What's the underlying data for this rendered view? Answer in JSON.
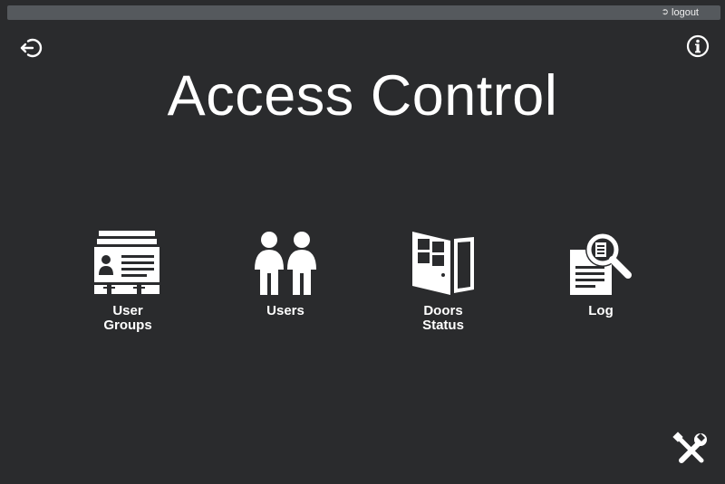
{
  "topbar": {
    "logout_label": "logout",
    "logout_icon": "logout-arrow-icon"
  },
  "header": {
    "title": "Access Control",
    "back_icon": "sign-out-icon",
    "info_icon": "info-icon"
  },
  "tiles": [
    {
      "label": "User Groups",
      "icon": "id-card-stack-icon"
    },
    {
      "label": "Users",
      "icon": "two-people-icon"
    },
    {
      "label": "Doors Status",
      "icon": "open-door-icon"
    },
    {
      "label": "Log",
      "icon": "document-magnifier-icon"
    }
  ],
  "footer": {
    "tools_icon": "wrench-screwdriver-icon"
  },
  "colors": {
    "background": "#2a2b2d",
    "topbar": "#55595d",
    "foreground": "#ffffff"
  }
}
